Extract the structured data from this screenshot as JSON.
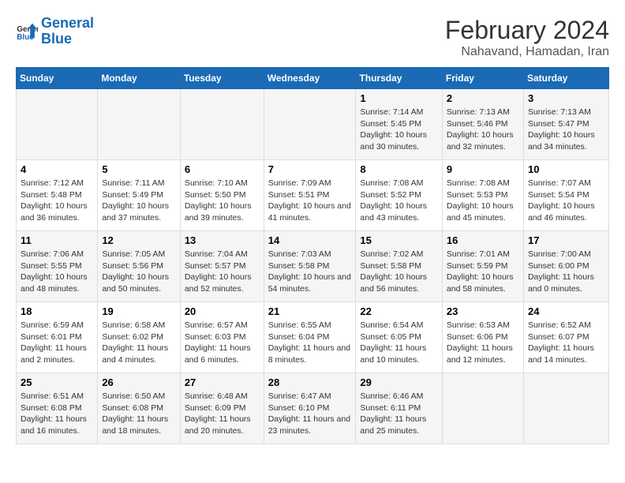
{
  "header": {
    "logo_line1": "General",
    "logo_line2": "Blue",
    "title": "February 2024",
    "subtitle": "Nahavand, Hamadan, Iran"
  },
  "weekdays": [
    "Sunday",
    "Monday",
    "Tuesday",
    "Wednesday",
    "Thursday",
    "Friday",
    "Saturday"
  ],
  "weeks": [
    [
      {
        "day": "",
        "info": ""
      },
      {
        "day": "",
        "info": ""
      },
      {
        "day": "",
        "info": ""
      },
      {
        "day": "",
        "info": ""
      },
      {
        "day": "1",
        "info": "Sunrise: 7:14 AM\nSunset: 5:45 PM\nDaylight: 10 hours and 30 minutes."
      },
      {
        "day": "2",
        "info": "Sunrise: 7:13 AM\nSunset: 5:46 PM\nDaylight: 10 hours and 32 minutes."
      },
      {
        "day": "3",
        "info": "Sunrise: 7:13 AM\nSunset: 5:47 PM\nDaylight: 10 hours and 34 minutes."
      }
    ],
    [
      {
        "day": "4",
        "info": "Sunrise: 7:12 AM\nSunset: 5:48 PM\nDaylight: 10 hours and 36 minutes."
      },
      {
        "day": "5",
        "info": "Sunrise: 7:11 AM\nSunset: 5:49 PM\nDaylight: 10 hours and 37 minutes."
      },
      {
        "day": "6",
        "info": "Sunrise: 7:10 AM\nSunset: 5:50 PM\nDaylight: 10 hours and 39 minutes."
      },
      {
        "day": "7",
        "info": "Sunrise: 7:09 AM\nSunset: 5:51 PM\nDaylight: 10 hours and 41 minutes."
      },
      {
        "day": "8",
        "info": "Sunrise: 7:08 AM\nSunset: 5:52 PM\nDaylight: 10 hours and 43 minutes."
      },
      {
        "day": "9",
        "info": "Sunrise: 7:08 AM\nSunset: 5:53 PM\nDaylight: 10 hours and 45 minutes."
      },
      {
        "day": "10",
        "info": "Sunrise: 7:07 AM\nSunset: 5:54 PM\nDaylight: 10 hours and 46 minutes."
      }
    ],
    [
      {
        "day": "11",
        "info": "Sunrise: 7:06 AM\nSunset: 5:55 PM\nDaylight: 10 hours and 48 minutes."
      },
      {
        "day": "12",
        "info": "Sunrise: 7:05 AM\nSunset: 5:56 PM\nDaylight: 10 hours and 50 minutes."
      },
      {
        "day": "13",
        "info": "Sunrise: 7:04 AM\nSunset: 5:57 PM\nDaylight: 10 hours and 52 minutes."
      },
      {
        "day": "14",
        "info": "Sunrise: 7:03 AM\nSunset: 5:58 PM\nDaylight: 10 hours and 54 minutes."
      },
      {
        "day": "15",
        "info": "Sunrise: 7:02 AM\nSunset: 5:58 PM\nDaylight: 10 hours and 56 minutes."
      },
      {
        "day": "16",
        "info": "Sunrise: 7:01 AM\nSunset: 5:59 PM\nDaylight: 10 hours and 58 minutes."
      },
      {
        "day": "17",
        "info": "Sunrise: 7:00 AM\nSunset: 6:00 PM\nDaylight: 11 hours and 0 minutes."
      }
    ],
    [
      {
        "day": "18",
        "info": "Sunrise: 6:59 AM\nSunset: 6:01 PM\nDaylight: 11 hours and 2 minutes."
      },
      {
        "day": "19",
        "info": "Sunrise: 6:58 AM\nSunset: 6:02 PM\nDaylight: 11 hours and 4 minutes."
      },
      {
        "day": "20",
        "info": "Sunrise: 6:57 AM\nSunset: 6:03 PM\nDaylight: 11 hours and 6 minutes."
      },
      {
        "day": "21",
        "info": "Sunrise: 6:55 AM\nSunset: 6:04 PM\nDaylight: 11 hours and 8 minutes."
      },
      {
        "day": "22",
        "info": "Sunrise: 6:54 AM\nSunset: 6:05 PM\nDaylight: 11 hours and 10 minutes."
      },
      {
        "day": "23",
        "info": "Sunrise: 6:53 AM\nSunset: 6:06 PM\nDaylight: 11 hours and 12 minutes."
      },
      {
        "day": "24",
        "info": "Sunrise: 6:52 AM\nSunset: 6:07 PM\nDaylight: 11 hours and 14 minutes."
      }
    ],
    [
      {
        "day": "25",
        "info": "Sunrise: 6:51 AM\nSunset: 6:08 PM\nDaylight: 11 hours and 16 minutes."
      },
      {
        "day": "26",
        "info": "Sunrise: 6:50 AM\nSunset: 6:08 PM\nDaylight: 11 hours and 18 minutes."
      },
      {
        "day": "27",
        "info": "Sunrise: 6:48 AM\nSunset: 6:09 PM\nDaylight: 11 hours and 20 minutes."
      },
      {
        "day": "28",
        "info": "Sunrise: 6:47 AM\nSunset: 6:10 PM\nDaylight: 11 hours and 23 minutes."
      },
      {
        "day": "29",
        "info": "Sunrise: 6:46 AM\nSunset: 6:11 PM\nDaylight: 11 hours and 25 minutes."
      },
      {
        "day": "",
        "info": ""
      },
      {
        "day": "",
        "info": ""
      }
    ]
  ]
}
